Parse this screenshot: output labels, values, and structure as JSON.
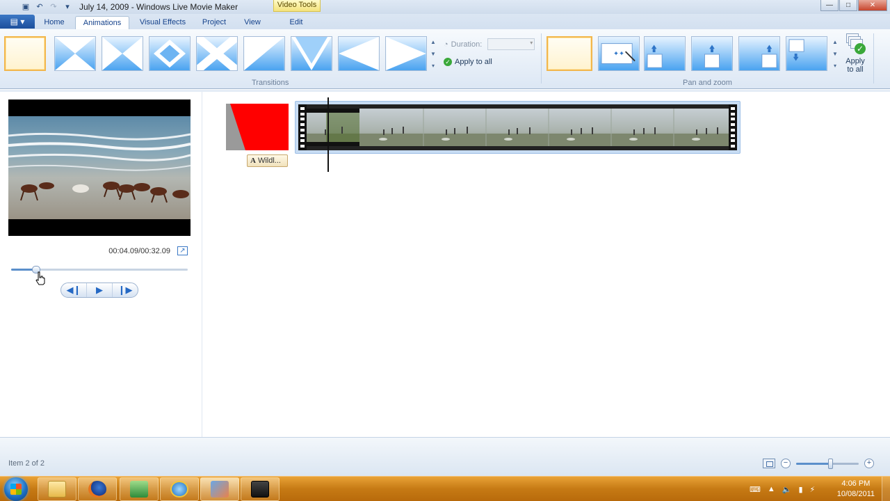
{
  "window": {
    "title": "July 14, 2009 - Windows Live Movie Maker",
    "contextual_tab": "Video Tools",
    "buttons": {
      "minimize": "—",
      "maximize": "□",
      "close": "✕"
    }
  },
  "quick_access": {
    "icons": [
      "save-icon",
      "undo-icon",
      "redo-icon",
      "dropdown-icon"
    ]
  },
  "tabs": [
    {
      "label": "Home",
      "active": false
    },
    {
      "label": "Animations",
      "active": true
    },
    {
      "label": "Visual Effects",
      "active": false
    },
    {
      "label": "Project",
      "active": false
    },
    {
      "label": "View",
      "active": false
    },
    {
      "label": "Edit",
      "active": false
    }
  ],
  "ribbon": {
    "transitions": {
      "label": "Transitions",
      "items": [
        "none",
        "cross-diagonal",
        "bowtie-horizontal",
        "diamond",
        "cross-x",
        "diagonal-wipe",
        "v-wipe",
        "arrow-left",
        "arrow-right"
      ]
    },
    "duration": {
      "label": "Duration:",
      "value": ""
    },
    "apply_to_all": "Apply to all",
    "pan_zoom": {
      "label": "Pan and zoom",
      "items": [
        "none",
        "automatic",
        "pan-up-left",
        "pan-up-center",
        "pan-up-right",
        "pan-down"
      ]
    },
    "apply_to_all_big": [
      "Apply",
      "to all"
    ]
  },
  "preview": {
    "time": "00:04.09/00:32.09",
    "seek_progress": 0.14,
    "controls": [
      "previous-frame",
      "play",
      "next-frame"
    ]
  },
  "storyboard": {
    "title_clip_label": "Wildl...",
    "title_clip_glyph": "A"
  },
  "status": {
    "text": "Item 2 of 2",
    "zoom_level": 0.55
  },
  "taskbar": {
    "apps": [
      "windows-explorer",
      "firefox",
      "app-green",
      "internet-explorer",
      "movie-maker",
      "hypercam"
    ],
    "time": "4:06 PM",
    "date": "10/08/2011"
  },
  "colors": {
    "accent": "#3b79c6",
    "selection": "#f2b64c",
    "taskbar": "#c67a14",
    "title_clip": "#ff0000"
  }
}
